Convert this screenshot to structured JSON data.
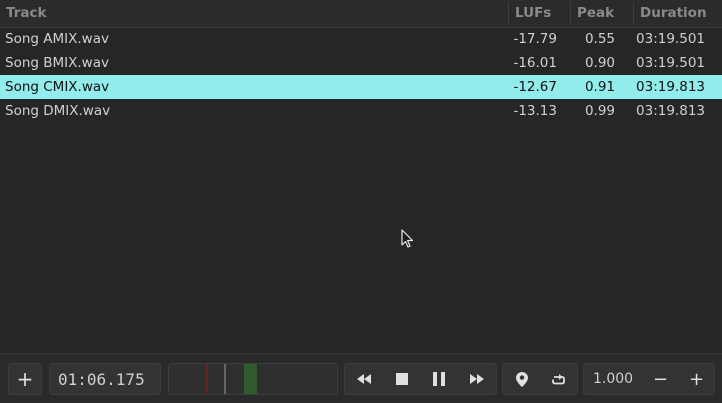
{
  "table": {
    "headers": {
      "track": "Track",
      "lufs": "LUFs",
      "peak": "Peak",
      "duration": "Duration"
    },
    "rows": [
      {
        "track": "Song AMIX.wav",
        "lufs": "-17.79",
        "peak": "0.55",
        "duration": "03:19.501",
        "selected": false
      },
      {
        "track": "Song BMIX.wav",
        "lufs": "-16.01",
        "peak": "0.90",
        "duration": "03:19.501",
        "selected": false
      },
      {
        "track": "Song CMIX.wav",
        "lufs": "-12.67",
        "peak": "0.91",
        "duration": "03:19.813",
        "selected": true
      },
      {
        "track": "Song DMIX.wav",
        "lufs": "-13.13",
        "peak": "0.99",
        "duration": "03:19.813",
        "selected": false
      }
    ]
  },
  "toolbar": {
    "add_label": "+",
    "time": "01:06.175",
    "speed": "1.000",
    "minus_label": "−",
    "plus_label": "+"
  },
  "icons": {
    "add": "plus-icon",
    "rewind": "rewind-icon",
    "stop": "stop-icon",
    "pause": "pause-icon",
    "fast_forward": "fast-forward-icon",
    "marker": "location-pin-icon",
    "loop": "loop-icon"
  },
  "colors": {
    "selection": "#93ecec",
    "background": "#262626",
    "waveform_playhead": "#8b1a1a",
    "waveform_region": "#2e5a2e"
  }
}
